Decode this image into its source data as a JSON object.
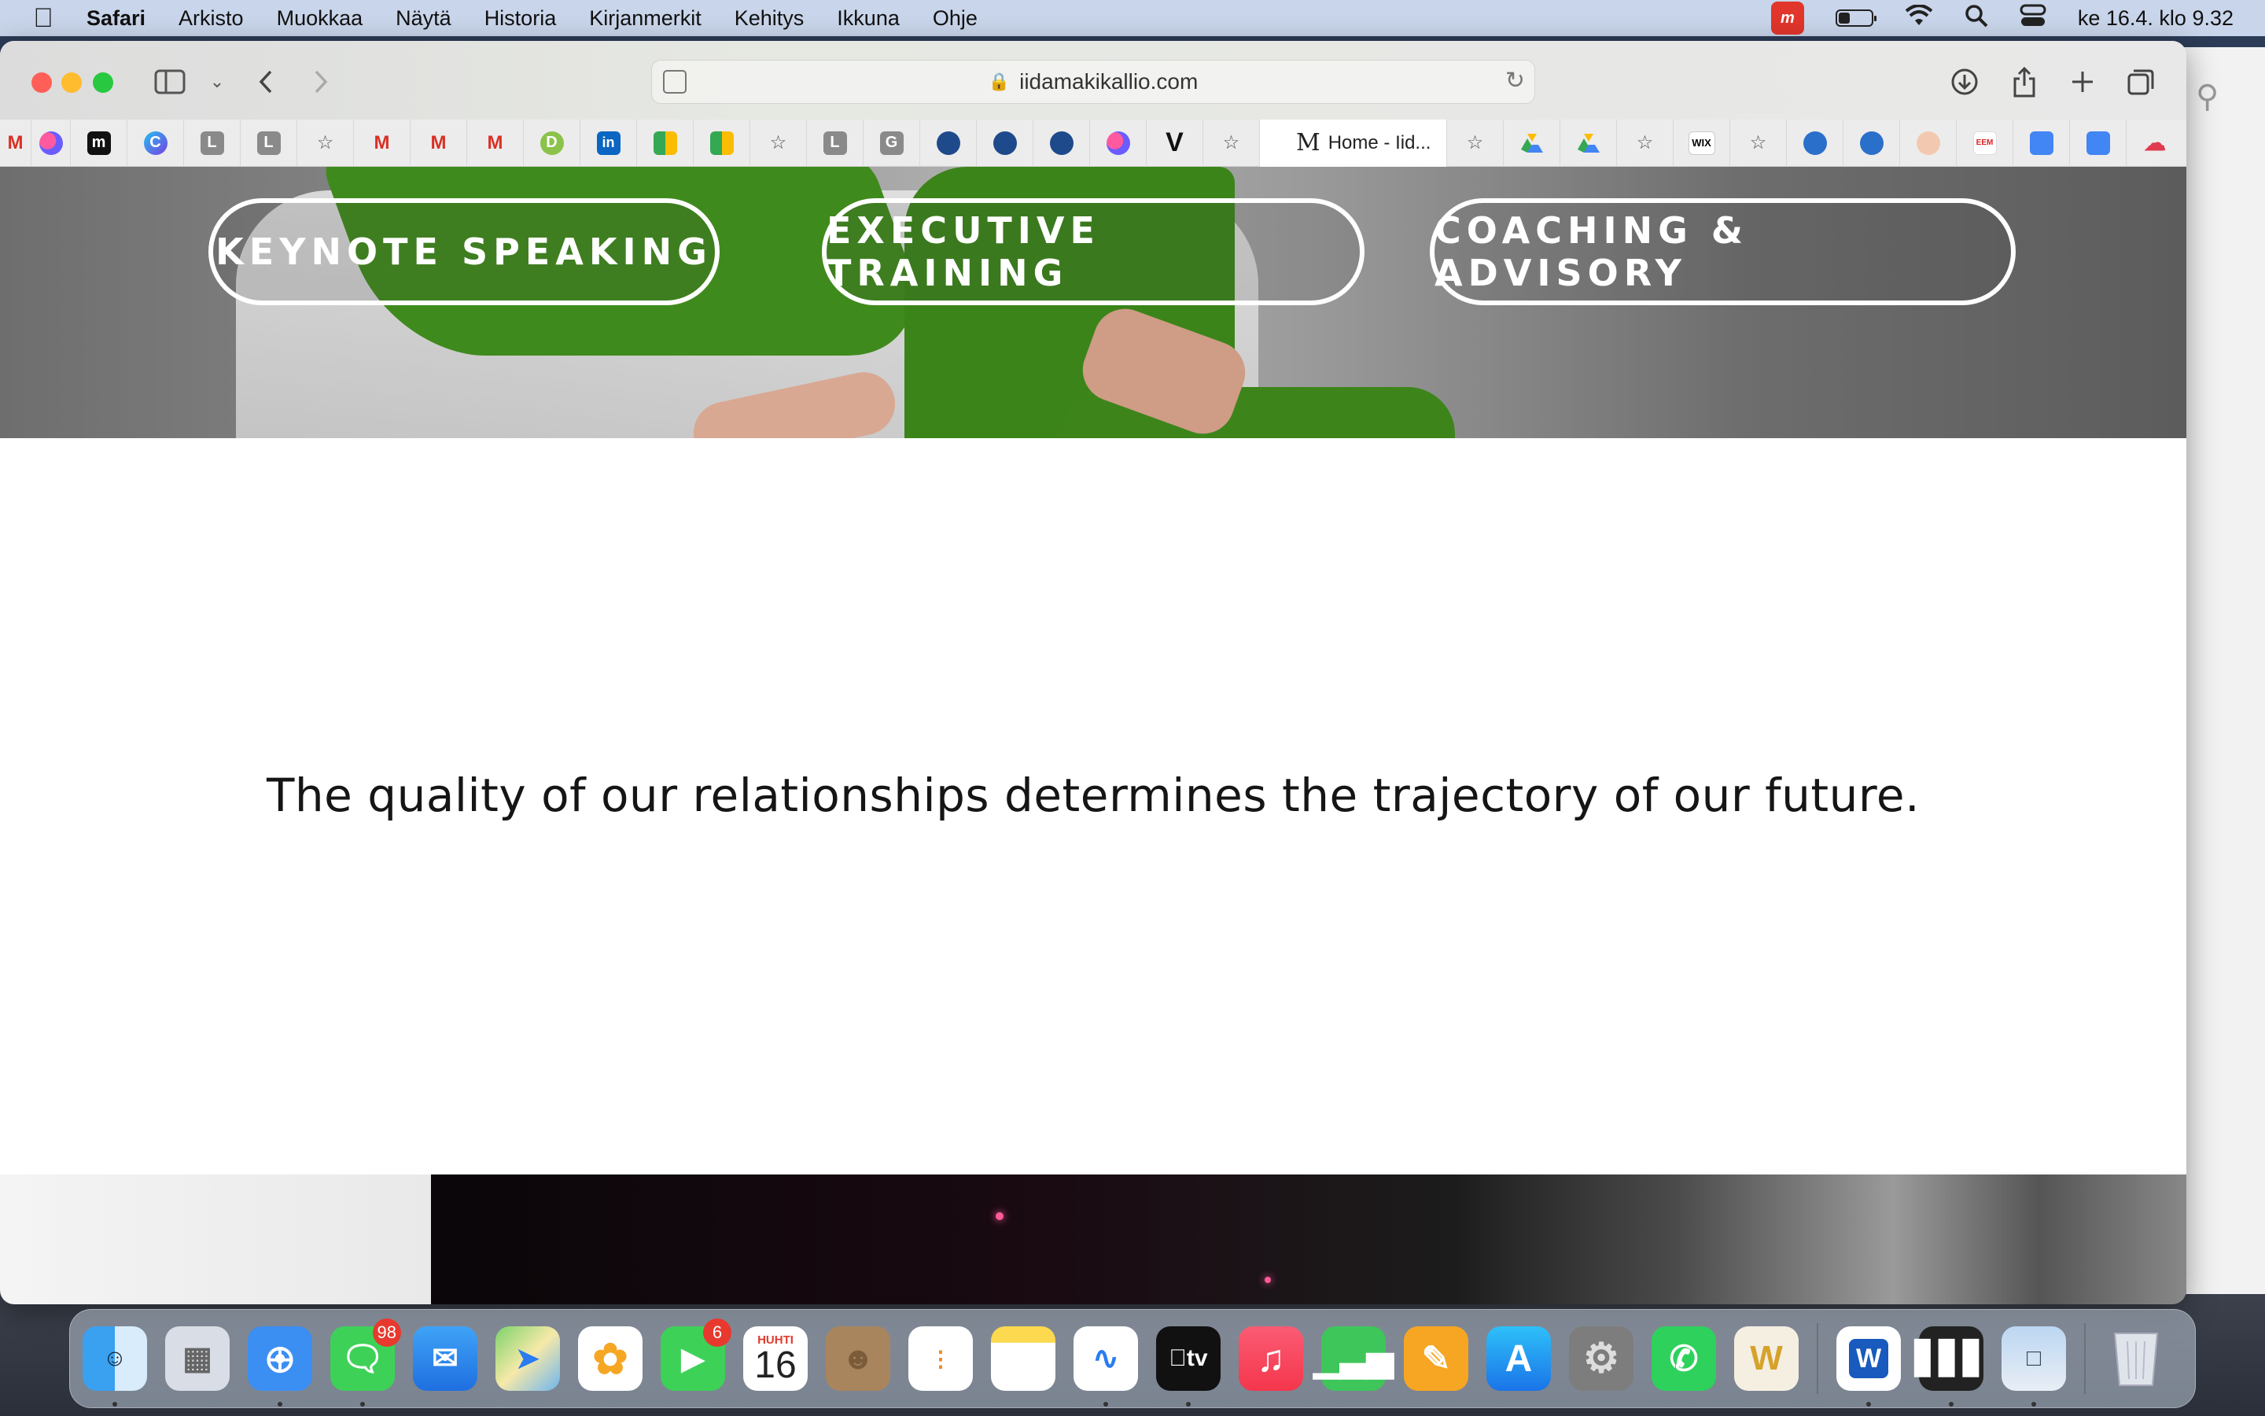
{
  "menubar": {
    "app_name": "Safari",
    "items": [
      "Arkisto",
      "Muokkaa",
      "Näytä",
      "Historia",
      "Kirjanmerkit",
      "Kehitys",
      "Ikkuna",
      "Ohje"
    ],
    "clock": "ke 16.4. klo 9.32",
    "battery_level": 0.35
  },
  "browser": {
    "url": "iidamakikallio.com",
    "active_tab_title": "Home - Iid...",
    "bookmarks": [
      {
        "icon": "gmail-icon"
      },
      {
        "icon": "circles-icon"
      },
      {
        "icon": "m-logo-icon",
        "label": "m"
      },
      {
        "icon": "c-logo-icon",
        "label": "C"
      },
      {
        "icon": "l-logo-icon",
        "label": "L"
      },
      {
        "icon": "l-logo-icon",
        "label": "L"
      },
      {
        "icon": "star-icon"
      },
      {
        "icon": "gmail-icon"
      },
      {
        "icon": "gmail-icon"
      },
      {
        "icon": "gmail-icon"
      },
      {
        "icon": "d-logo-icon",
        "label": "D"
      },
      {
        "icon": "linkedin-icon",
        "label": "in"
      },
      {
        "icon": "meet-icon"
      },
      {
        "icon": "meet-icon"
      },
      {
        "icon": "star-icon"
      },
      {
        "icon": "l-logo-icon",
        "label": "L"
      },
      {
        "icon": "g-logo-icon",
        "label": "G"
      },
      {
        "icon": "blue-circle-icon"
      },
      {
        "icon": "blue-circle-icon"
      },
      {
        "icon": "blue-circle-icon"
      },
      {
        "icon": "circles-icon"
      },
      {
        "icon": "v-logo-icon",
        "label": "V"
      },
      {
        "icon": "star-icon"
      }
    ],
    "bookmarks_after": [
      {
        "icon": "star-icon"
      },
      {
        "icon": "drive-icon"
      },
      {
        "icon": "drive-icon"
      },
      {
        "icon": "star-icon"
      },
      {
        "icon": "wix-icon",
        "label": "WIX"
      },
      {
        "icon": "star-icon"
      },
      {
        "icon": "s-logo-icon"
      },
      {
        "icon": "s-logo-icon"
      },
      {
        "icon": "seal-icon"
      },
      {
        "icon": "eem-icon",
        "label": "EEM"
      },
      {
        "icon": "docs-icon"
      },
      {
        "icon": "docs-icon"
      },
      {
        "icon": "cloud-icon"
      }
    ]
  },
  "page": {
    "buttons": {
      "keynote": "KEYNOTE SPEAKING",
      "training": "EXECUTIVE TRAINING",
      "coaching": "COACHING & ADVISORY"
    },
    "quote": "The quality of our relationships determines the trajectory of our future."
  },
  "dock": {
    "messages_badge": "98",
    "facetime_badge": "6",
    "calendar_month": "HUHTI",
    "calendar_day": "16",
    "apps": [
      "finder",
      "launchpad",
      "safari",
      "messages",
      "mail",
      "maps",
      "photos",
      "facetime",
      "calendar",
      "contacts",
      "reminders",
      "notes",
      "freeform",
      "tv",
      "music",
      "numbers",
      "pages",
      "app-store",
      "system-settings",
      "whatsapp",
      "w-app",
      "word",
      "piano",
      "preview",
      "trash"
    ]
  },
  "colors": {
    "menubar": "#c9d5ea",
    "green_sleeve": "#3f8a1c",
    "pill_border": "#ffffff"
  }
}
